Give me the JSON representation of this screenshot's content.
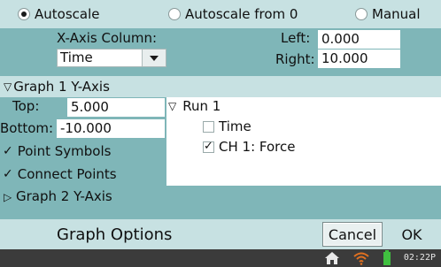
{
  "scale_options": {
    "autoscale": "Autoscale",
    "autoscale_from_0": "Autoscale from 0",
    "manual": "Manual",
    "selected": "Autoscale"
  },
  "x_axis": {
    "column_label": "X-Axis Column:",
    "column_value": "Time",
    "left_label": "Left:",
    "left_value": "0.000",
    "right_label": "Right:",
    "right_value": "10.000"
  },
  "graph1": {
    "header": "Graph 1 Y-Axis",
    "top_label": "Top:",
    "top_value": "5.000",
    "bottom_label": "Bottom:",
    "bottom_value": "-10.000",
    "point_symbols_label": "Point Symbols",
    "point_symbols_checked": true,
    "connect_points_label": "Connect Points",
    "connect_points_checked": true
  },
  "tree": {
    "run_label": "Run 1",
    "items": [
      {
        "label": "Time",
        "checked": false
      },
      {
        "label": "CH 1: Force",
        "checked": true
      }
    ]
  },
  "graph2": {
    "header": "Graph 2 Y-Axis"
  },
  "footer": {
    "title": "Graph Options",
    "cancel_label": "Cancel",
    "ok_label": "OK"
  },
  "status_bar": {
    "time": "02:22P",
    "icons": [
      "home-icon",
      "wifi-icon",
      "battery-icon"
    ]
  },
  "colors": {
    "teal_panel": "#7fb6b8",
    "light_panel": "#c7e1e2",
    "status_bar": "#3b3b3b",
    "wifi": "#e07020",
    "battery": "#40c040"
  }
}
